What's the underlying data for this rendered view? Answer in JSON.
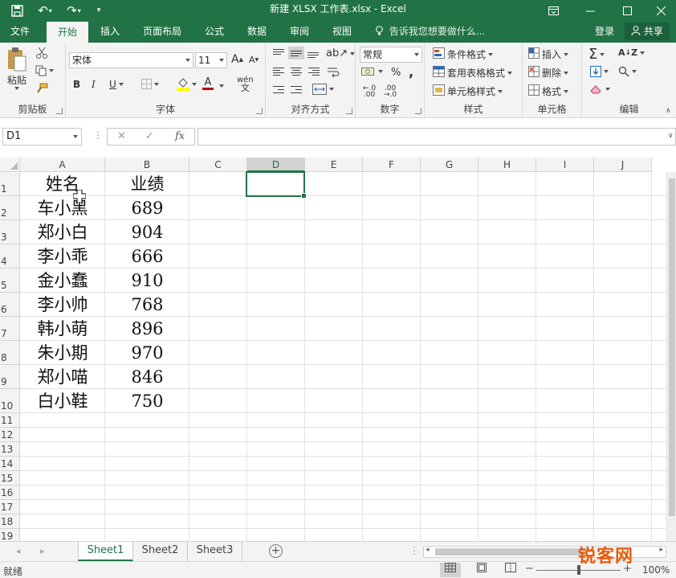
{
  "window": {
    "title": "新建 XLSX 工作表.xlsx - Excel",
    "ribbon_options_icon": "ribbon-display-options-icon",
    "minimize_icon": "minimize-icon",
    "maximize_icon": "maximize-icon",
    "close_icon": "close-icon"
  },
  "quick_access": [
    "save-icon",
    "undo-icon",
    "redo-icon",
    "customize-qat-icon"
  ],
  "tabs": [
    {
      "label": "文件"
    },
    {
      "label": "开始",
      "active": true
    },
    {
      "label": "插入"
    },
    {
      "label": "页面布局"
    },
    {
      "label": "公式"
    },
    {
      "label": "数据"
    },
    {
      "label": "审阅"
    },
    {
      "label": "视图"
    }
  ],
  "tell_me": "告诉我您想要做什么...",
  "login": "登录",
  "share": "共享",
  "ribbon": {
    "clipboard": {
      "label": "剪贴板",
      "paste": "粘贴"
    },
    "font": {
      "label": "字体",
      "font_name": "宋体",
      "font_size": "11",
      "grow": "A",
      "shrink": "A",
      "bold": "B",
      "italic": "I",
      "underline": "U",
      "font_color": "A",
      "phonetic": "wén"
    },
    "alignment": {
      "label": "对齐方式"
    },
    "number": {
      "label": "数字",
      "format": "常规",
      "percent": "%",
      "comma": ","
    },
    "styles": {
      "label": "样式",
      "conditional": "条件格式",
      "table": "套用表格格式",
      "cell_styles": "单元格样式"
    },
    "cells": {
      "label": "单元格",
      "insert": "插入",
      "delete": "删除",
      "format": "格式"
    },
    "editing": {
      "label": "编辑"
    }
  },
  "formula_bar": {
    "name_box": "D1",
    "cancel": "✕",
    "enter": "✓",
    "fx": "fx",
    "value": ""
  },
  "columns": [
    "A",
    "B",
    "C",
    "D",
    "E",
    "F",
    "G",
    "H",
    "I",
    "J"
  ],
  "selected_column": "D",
  "rows": [
    "1",
    "2",
    "3",
    "4",
    "5",
    "6",
    "7",
    "8",
    "9",
    "10",
    "11",
    "12",
    "13",
    "14",
    "15",
    "16",
    "17",
    "18",
    "19"
  ],
  "cells": {
    "headers": [
      "姓名",
      "业绩"
    ],
    "records": [
      {
        "name": "车小黑",
        "score": "689"
      },
      {
        "name": "郑小白",
        "score": "904"
      },
      {
        "name": "李小乖",
        "score": "666"
      },
      {
        "name": "金小蠢",
        "score": "910"
      },
      {
        "name": "李小帅",
        "score": "768"
      },
      {
        "name": "韩小萌",
        "score": "896"
      },
      {
        "name": "朱小期",
        "score": "970"
      },
      {
        "name": "郑小喵",
        "score": "846"
      },
      {
        "name": "白小鞋",
        "score": "750"
      }
    ]
  },
  "sheets": [
    {
      "label": "Sheet1",
      "active": true
    },
    {
      "label": "Sheet2"
    },
    {
      "label": "Sheet3"
    }
  ],
  "status": {
    "ready": "就绪",
    "zoom": "100%"
  },
  "watermark": "锐客网",
  "colors": {
    "accent": "#217346",
    "ribbon_bg": "#f3f3f3",
    "grid_line": "#e1e1e1"
  }
}
